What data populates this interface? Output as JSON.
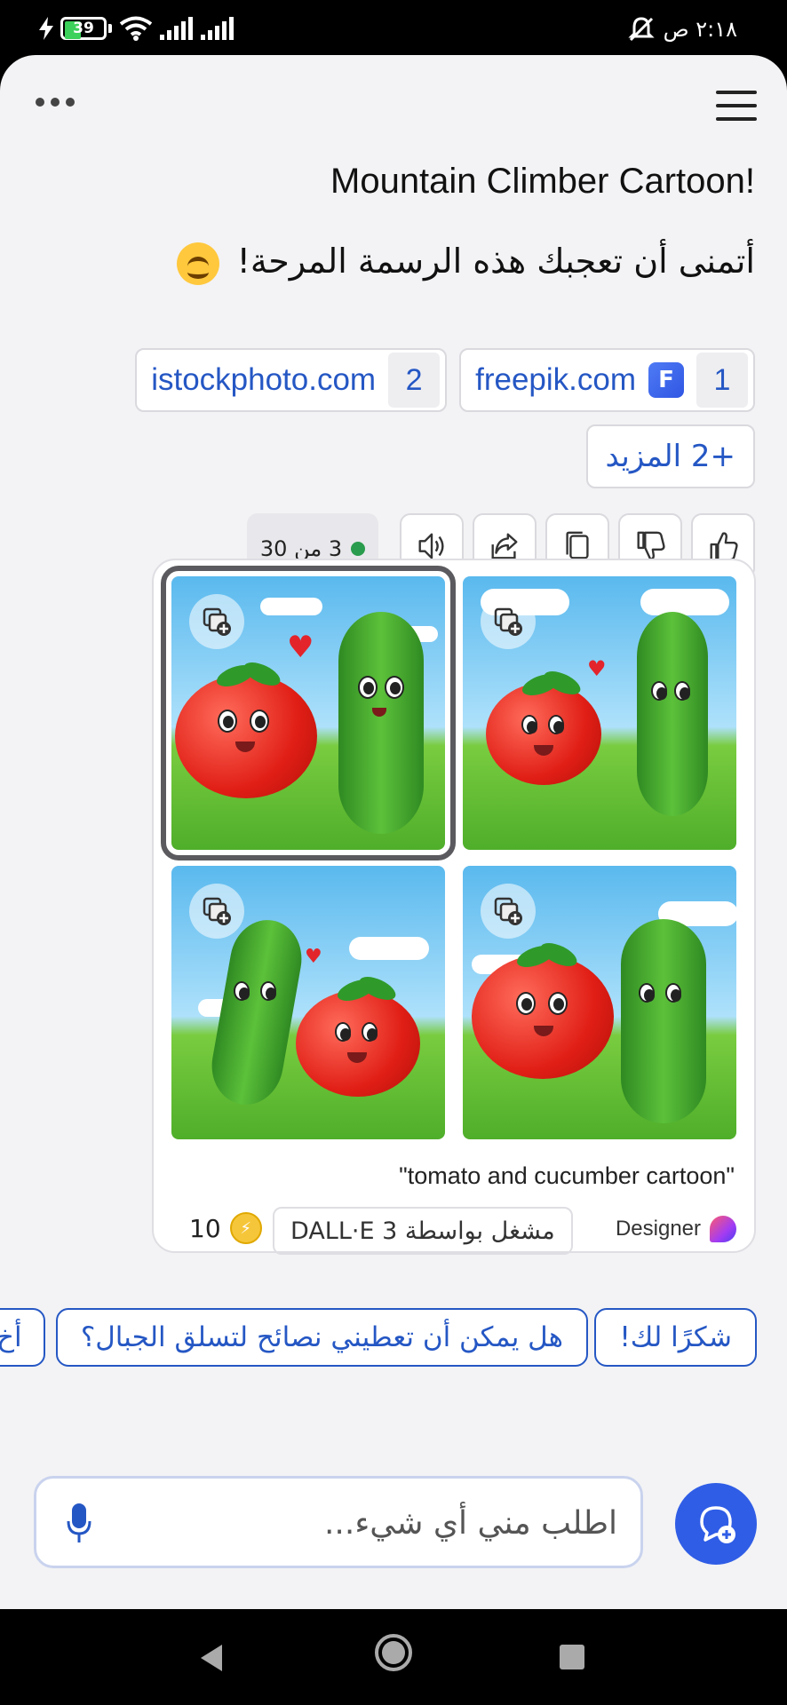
{
  "status_bar": {
    "battery": "39",
    "time": "٢:١٨ ص"
  },
  "chat": {
    "title": "Mountain Climber Cartoon!",
    "message": "أتمنى أن تعجبك هذه الرسمة المرحة!",
    "sources": [
      {
        "num": "1",
        "label": "freepik.com",
        "icon": "freepik-favicon"
      },
      {
        "num": "2",
        "label": "istockphoto.com"
      }
    ],
    "more_label": "+2 المزيد",
    "counter": "3 من 30"
  },
  "image_card": {
    "prompt": "\"tomato and cucumber cartoon\"",
    "coins": "10",
    "powered_by": "مشغل بواسطة DALL·E 3",
    "designer": "Designer",
    "selected_index": 0
  },
  "suggestions": [
    {
      "label": "شكرًا لك!"
    },
    {
      "label": "هل يمكن أن تعطيني نصائح لتسلق الجبال؟"
    },
    {
      "label": "أخ"
    }
  ],
  "input": {
    "placeholder": "اطلب مني أي شيء..."
  },
  "colors": {
    "accent": "#2557c4",
    "new_chat": "#2f5de6",
    "counter_dot": "#2a9c4d"
  }
}
